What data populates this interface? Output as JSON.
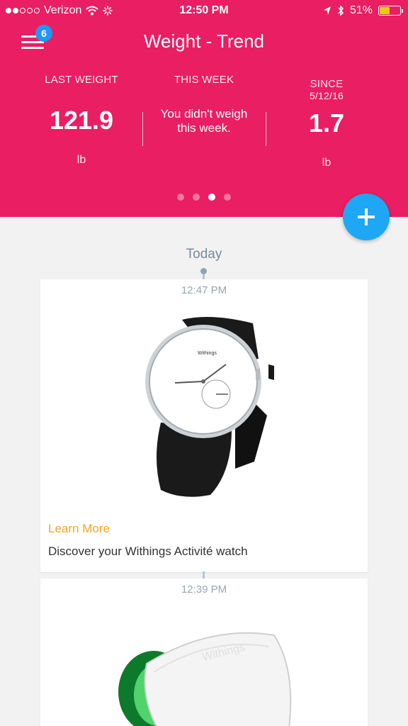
{
  "status_bar": {
    "carrier": "Verizon",
    "time": "12:50 PM",
    "battery": "51%",
    "battery_level": 0.51
  },
  "header": {
    "title": "Weight - Trend",
    "menu_badge": "6",
    "accent_color": "#e91e63"
  },
  "stats": {
    "last_weight": {
      "label": "LAST WEIGHT",
      "value": "121.9",
      "unit": "lb"
    },
    "this_week": {
      "label": "THIS WEEK",
      "message": "You didn't weigh this week."
    },
    "since": {
      "label_line1": "SINCE",
      "label_line2": "5/12/16",
      "value": "1.7",
      "unit": "lb"
    }
  },
  "pager": {
    "count": 4,
    "active_index": 2
  },
  "timeline": {
    "day_label": "Today",
    "entries": [
      {
        "time": "12:47 PM",
        "link": "Learn More",
        "description": "Discover your Withings Activité watch",
        "image": "withings-activite-watch",
        "watch_brand": "Withings"
      },
      {
        "time": "12:39 PM",
        "image": "withings-blood-pressure-cuff",
        "cuff_brand": "Withings"
      }
    ]
  },
  "icons": {
    "menu": "hamburger-icon",
    "add": "plus-icon",
    "wifi": "wifi-icon",
    "location": "location-arrow-icon",
    "bluetooth": "bluetooth-icon"
  }
}
